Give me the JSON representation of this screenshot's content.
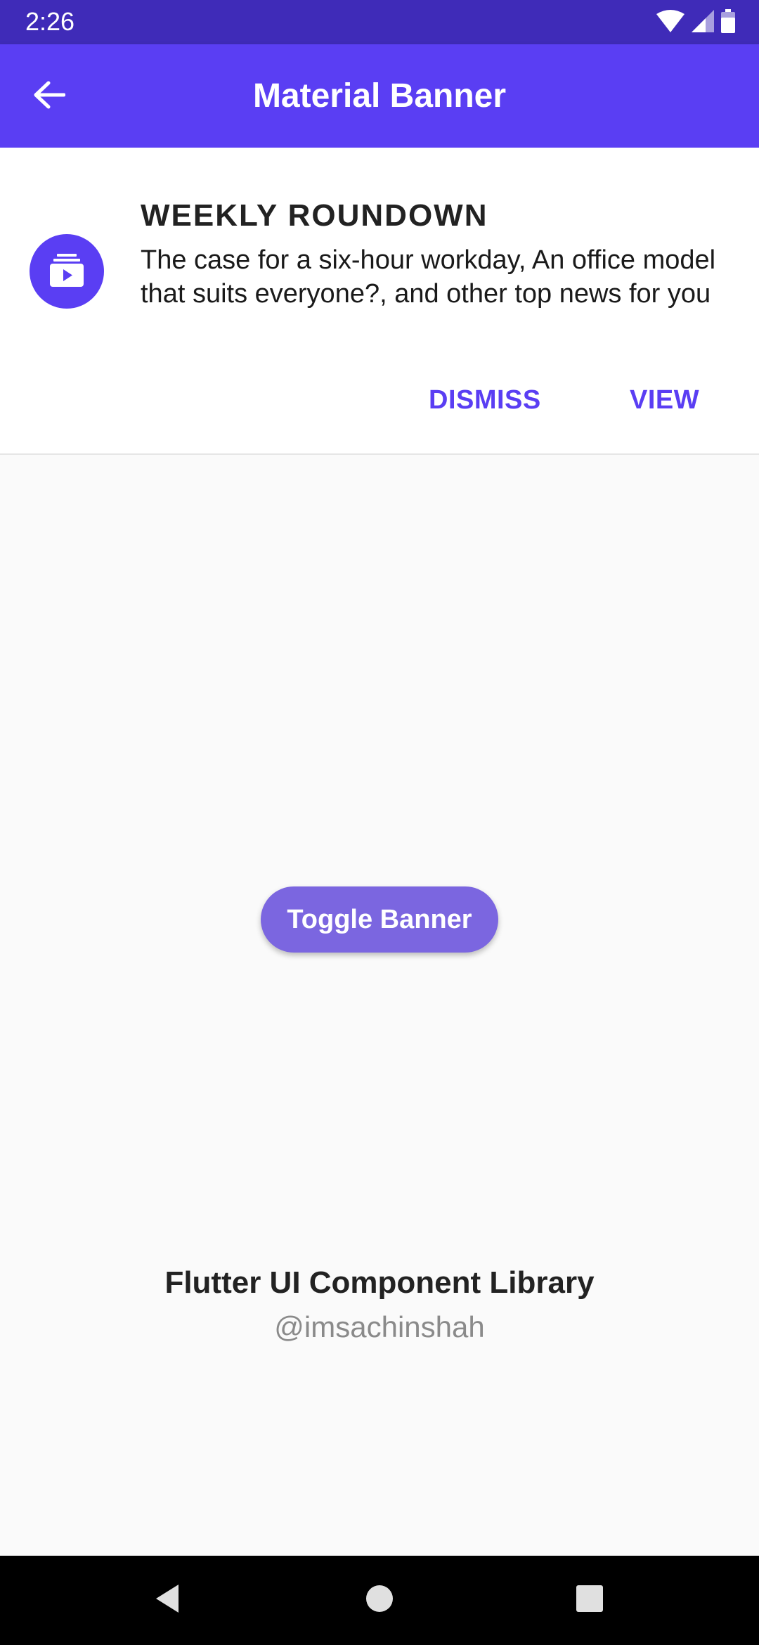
{
  "status_bar": {
    "time": "2:26",
    "icons": [
      "wifi-icon",
      "signal-icon",
      "battery-icon"
    ]
  },
  "app_bar": {
    "title": "Material Banner",
    "back_icon": "arrow-back-icon",
    "color": "#5a3ef3"
  },
  "banner": {
    "icon": "subscriptions-icon",
    "heading": "WEEKLY ROUNDOWN",
    "body": "The case for a six-hour workday, An office model that suits everyone?, and other top news for you",
    "actions": {
      "dismiss": "DISMISS",
      "view": "VIEW"
    }
  },
  "main": {
    "toggle_button": "Toggle Banner"
  },
  "footer": {
    "title": "Flutter UI Component Library",
    "subtitle": "@imsachinshah"
  },
  "nav_bar": {
    "icons": [
      "back-triangle-icon",
      "home-circle-icon",
      "recents-square-icon"
    ]
  },
  "colors": {
    "accent": "#5a3ef3",
    "status_bar": "#3f2bb8",
    "toggle_button": "#7b66e0"
  }
}
